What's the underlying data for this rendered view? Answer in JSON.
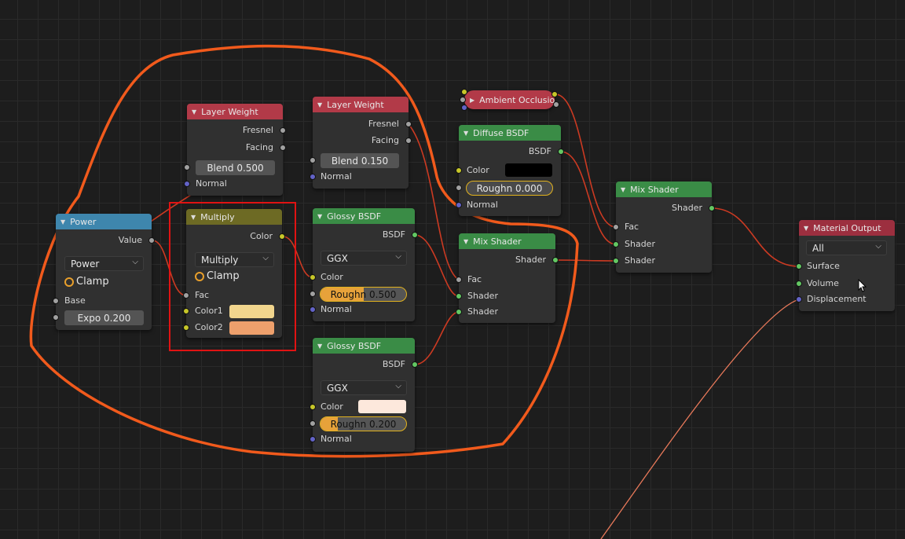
{
  "nodes": {
    "power": {
      "title": "Power",
      "value_label": "Value",
      "operation": "Power",
      "clamp_label": "Clamp",
      "base_label": "Base",
      "exponent_field": "Expo   0.200"
    },
    "layer_weight_1": {
      "title": "Layer Weight",
      "fresnel_label": "Fresnel",
      "facing_label": "Facing",
      "blend_field": "Blend   0.500",
      "normal_label": "Normal"
    },
    "layer_weight_2": {
      "title": "Layer Weight",
      "fresnel_label": "Fresnel",
      "facing_label": "Facing",
      "blend_field": "Blend   0.150",
      "normal_label": "Normal"
    },
    "multiply": {
      "title": "Multiply",
      "color_out_label": "Color",
      "blend_mode": "Multiply",
      "clamp_label": "Clamp",
      "fac_label": "Fac",
      "color1_label": "Color1",
      "color2_label": "Color2",
      "color1": "#f1d58d",
      "color2": "#eea06c"
    },
    "glossy_1": {
      "title": "Glossy BSDF",
      "bsdf_label": "BSDF",
      "distribution": "GGX",
      "color_label": "Color",
      "roughness_field": "Roughn   0.500",
      "roughness": 0.5,
      "normal_label": "Normal"
    },
    "glossy_2": {
      "title": "Glossy BSDF",
      "bsdf_label": "BSDF",
      "distribution": "GGX",
      "color_label": "Color",
      "color": "#fde8dc",
      "roughness_field": "Roughn   0.200",
      "roughness": 0.2,
      "normal_label": "Normal"
    },
    "ambient_occlusion": {
      "title": "Ambient Occlusion"
    },
    "diffuse": {
      "title": "Diffuse BSDF",
      "bsdf_label": "BSDF",
      "color_label": "Color",
      "color": "#000000",
      "roughness_field": "Roughn   0.000",
      "roughness": 0.0,
      "normal_label": "Normal"
    },
    "mix_shader_1": {
      "title": "Mix Shader",
      "shader_out_label": "Shader",
      "fac_label": "Fac",
      "shader1_label": "Shader",
      "shader2_label": "Shader"
    },
    "mix_shader_2": {
      "title": "Mix Shader",
      "shader_out_label": "Shader",
      "fac_label": "Fac",
      "shader1_label": "Shader",
      "shader2_label": "Shader"
    },
    "material_output": {
      "title": "Material Output",
      "target": "All",
      "surface_label": "Surface",
      "volume_label": "Volume",
      "displacement_label": "Displacement"
    }
  },
  "colors": {
    "wire": "#d23a1e",
    "annotation_stroke": "#f15a1c",
    "highlight_box": "#e01313"
  },
  "icons": [
    "collapse-triangle-icon",
    "dropdown-chevron-icon",
    "mouse-cursor-icon"
  ]
}
